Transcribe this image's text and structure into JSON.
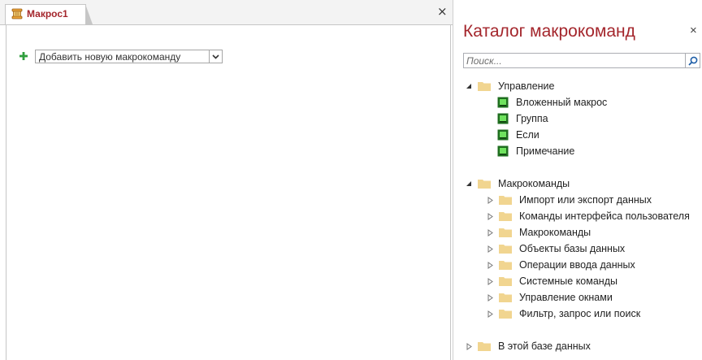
{
  "tab": {
    "title": "Макрос1",
    "close": "×"
  },
  "editor": {
    "add_action_placeholder": "Добавить новую макрокоманду"
  },
  "catalog": {
    "title": "Каталог макрокоманд",
    "close": "×",
    "search_placeholder": "Поиск...",
    "groups": [
      {
        "label": "Управление",
        "expanded": true,
        "items": [
          "Вложенный макрос",
          "Группа",
          "Если",
          "Примечание"
        ]
      },
      {
        "label": "Макрокоманды",
        "expanded": true,
        "folders": [
          "Импорт или экспорт данных",
          "Команды интерфейса пользователя",
          "Макрокоманды",
          "Объекты базы данных",
          "Операции ввода данных",
          "Системные команды",
          "Управление окнами",
          "Фильтр, запрос или поиск"
        ]
      },
      {
        "label": "В этой базе данных",
        "expanded": false
      }
    ]
  },
  "colors": {
    "accent": "#a4262c",
    "folder": "#f1d590",
    "tile_green": "#3cb43c",
    "plus": "#2e9e3c"
  }
}
